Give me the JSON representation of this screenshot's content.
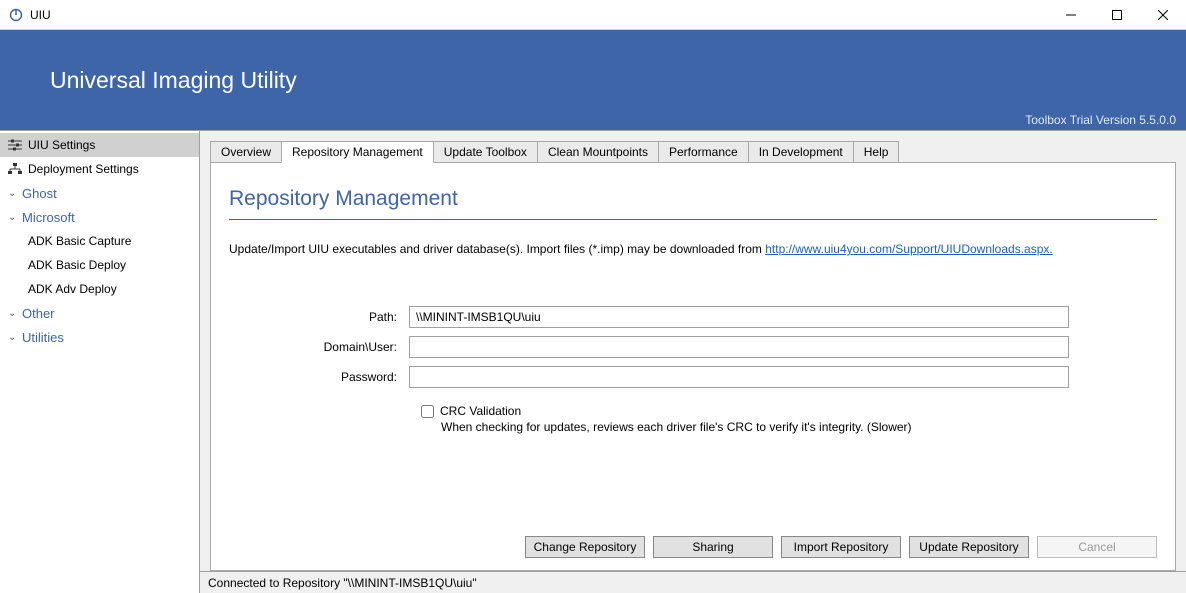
{
  "window": {
    "title": "UIU"
  },
  "header": {
    "title": "Universal Imaging Utility",
    "version": "Toolbox Trial Version 5.5.0.0"
  },
  "sidebar": {
    "items": [
      {
        "label": "UIU Settings",
        "type": "item",
        "selected": true
      },
      {
        "label": "Deployment Settings",
        "type": "item"
      },
      {
        "label": "Ghost",
        "type": "group"
      },
      {
        "label": "Microsoft",
        "type": "group"
      },
      {
        "label": "ADK Basic Capture",
        "type": "sub"
      },
      {
        "label": "ADK Basic Deploy",
        "type": "sub"
      },
      {
        "label": "ADK Adv Deploy",
        "type": "sub"
      },
      {
        "label": "Other",
        "type": "group"
      },
      {
        "label": "Utilities",
        "type": "group"
      }
    ]
  },
  "tabs": [
    {
      "label": "Overview"
    },
    {
      "label": "Repository Management",
      "active": true
    },
    {
      "label": "Update Toolbox"
    },
    {
      "label": "Clean Mountpoints"
    },
    {
      "label": "Performance"
    },
    {
      "label": "In Development"
    },
    {
      "label": "Help"
    }
  ],
  "page": {
    "title": "Repository Management",
    "desc_prefix": "Update/Import UIU executables and driver database(s). Import files (*.imp) may be downloaded from ",
    "desc_link": "http://www.uiu4you.com/Support/UIUDownloads.aspx.",
    "form": {
      "path_label": "Path:",
      "path_value": "\\\\MININT-IMSB1QU\\uiu",
      "domain_label": "Domain\\User:",
      "domain_value": "",
      "password_label": "Password:",
      "password_value": "",
      "crc_label": "CRC Validation",
      "crc_hint": "When checking for updates, reviews each driver file's CRC to verify it's integrity. (Slower)"
    },
    "buttons": {
      "change": "Change Repository",
      "sharing": "Sharing",
      "import": "Import Repository",
      "update": "Update Repository",
      "cancel": "Cancel"
    }
  },
  "statusbar": "Connected to Repository \"\\\\MININT-IMSB1QU\\uiu\""
}
